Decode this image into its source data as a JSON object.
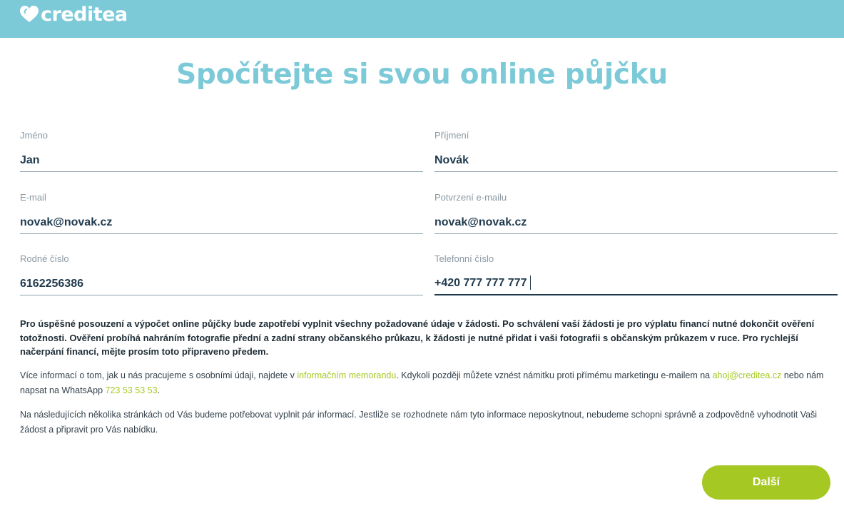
{
  "brand": {
    "logo_text": "creditea",
    "icon": "heart-logo-icon"
  },
  "page": {
    "title": "Spočítejte si svou online půjčku"
  },
  "form": {
    "first_name": {
      "label": "Jméno",
      "value": "Jan"
    },
    "last_name": {
      "label": "Příjmení",
      "value": "Novák"
    },
    "email": {
      "label": "E-mail",
      "value": "novak@novak.cz"
    },
    "email_confirm": {
      "label": "Potvrzení e-mailu",
      "value": "novak@novak.cz"
    },
    "birth_number": {
      "label": "Rodné číslo",
      "value": "6162256386"
    },
    "phone": {
      "label": "Telefonní číslo",
      "value": "+420 777 777 777"
    }
  },
  "info": {
    "paragraph1": "Pro úspěšné posouzení a výpočet online půjčky bude zapotřebí vyplnit všechny požadované údaje v žádosti. Po schválení vaší žádosti je pro výplatu financí nutné dokončit ověření totožnosti. Ověření probíhá nahráním fotografie přední a zadní strany občanského průkazu, k žádosti je nutné přidat i vaši fotografii s občanským průkazem v ruce. Pro rychlejší načerpání financí, mějte prosím toto připraveno předem.",
    "paragraph2_part1": "Více informací o tom, jak u nás pracujeme s osobními údaji, najdete v ",
    "paragraph2_link1": "informačním memorandu",
    "paragraph2_part2": ". Kdykoli později můžete vznést námitku proti přímému marketingu e-mailem na ",
    "paragraph2_link2": "ahoj@creditea.cz",
    "paragraph2_part3": " nebo nám napsat na WhatsApp ",
    "paragraph2_link3": "723 53 53 53",
    "paragraph2_part4": ".",
    "paragraph3": "Na následujících několika stránkách od Vás budeme potřebovat vyplnit pár informací. Jestliže se rozhodnete nám tyto informace neposkytnout, nebudeme schopni správně a zodpovědně vyhodnotit Vaši žádost a připravit pro Vás nabídku."
  },
  "actions": {
    "next_label": "Další"
  },
  "colors": {
    "header": "#7ccad8",
    "title": "#7ccad8",
    "accent": "#a6c823",
    "text": "#1f3a4d"
  }
}
